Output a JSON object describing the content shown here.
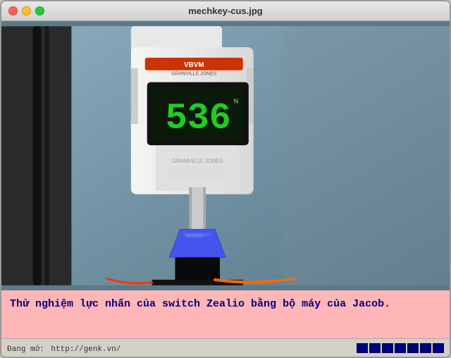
{
  "window": {
    "title": "mechkey-cus.jpg"
  },
  "caption": {
    "text": "Thử nghiệm lực nhấn của switch Zealio bằng bộ máy của Jacob."
  },
  "status_bar": {
    "url_label": "Đang mở:",
    "url": "http://genk.vn/",
    "progress_segments": 7
  },
  "gauge": {
    "reading": "536"
  },
  "traffic_lights": {
    "red": "close",
    "yellow": "minimize",
    "green": "maximize"
  }
}
